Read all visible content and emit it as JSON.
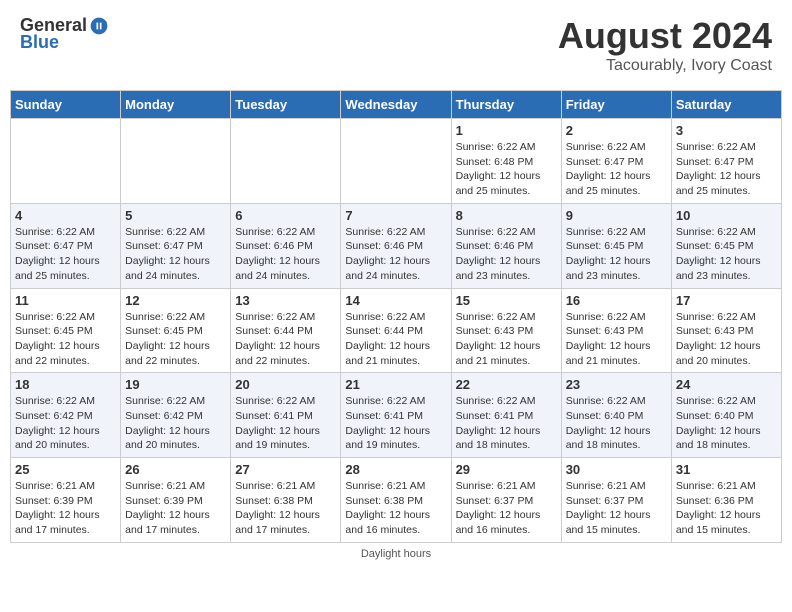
{
  "header": {
    "logo_general": "General",
    "logo_blue": "Blue",
    "main_title": "August 2024",
    "subtitle": "Tacourably, Ivory Coast"
  },
  "days_of_week": [
    "Sunday",
    "Monday",
    "Tuesday",
    "Wednesday",
    "Thursday",
    "Friday",
    "Saturday"
  ],
  "footer": {
    "text": "Daylight hours"
  },
  "weeks": [
    {
      "days": [
        {
          "num": "",
          "info": "",
          "empty": true
        },
        {
          "num": "",
          "info": "",
          "empty": true
        },
        {
          "num": "",
          "info": "",
          "empty": true
        },
        {
          "num": "",
          "info": "",
          "empty": true
        },
        {
          "num": "1",
          "info": "Sunrise: 6:22 AM\nSunset: 6:48 PM\nDaylight: 12 hours\nand 25 minutes."
        },
        {
          "num": "2",
          "info": "Sunrise: 6:22 AM\nSunset: 6:47 PM\nDaylight: 12 hours\nand 25 minutes."
        },
        {
          "num": "3",
          "info": "Sunrise: 6:22 AM\nSunset: 6:47 PM\nDaylight: 12 hours\nand 25 minutes."
        }
      ]
    },
    {
      "days": [
        {
          "num": "4",
          "info": "Sunrise: 6:22 AM\nSunset: 6:47 PM\nDaylight: 12 hours\nand 25 minutes."
        },
        {
          "num": "5",
          "info": "Sunrise: 6:22 AM\nSunset: 6:47 PM\nDaylight: 12 hours\nand 24 minutes."
        },
        {
          "num": "6",
          "info": "Sunrise: 6:22 AM\nSunset: 6:46 PM\nDaylight: 12 hours\nand 24 minutes."
        },
        {
          "num": "7",
          "info": "Sunrise: 6:22 AM\nSunset: 6:46 PM\nDaylight: 12 hours\nand 24 minutes."
        },
        {
          "num": "8",
          "info": "Sunrise: 6:22 AM\nSunset: 6:46 PM\nDaylight: 12 hours\nand 23 minutes."
        },
        {
          "num": "9",
          "info": "Sunrise: 6:22 AM\nSunset: 6:45 PM\nDaylight: 12 hours\nand 23 minutes."
        },
        {
          "num": "10",
          "info": "Sunrise: 6:22 AM\nSunset: 6:45 PM\nDaylight: 12 hours\nand 23 minutes."
        }
      ]
    },
    {
      "days": [
        {
          "num": "11",
          "info": "Sunrise: 6:22 AM\nSunset: 6:45 PM\nDaylight: 12 hours\nand 22 minutes."
        },
        {
          "num": "12",
          "info": "Sunrise: 6:22 AM\nSunset: 6:45 PM\nDaylight: 12 hours\nand 22 minutes."
        },
        {
          "num": "13",
          "info": "Sunrise: 6:22 AM\nSunset: 6:44 PM\nDaylight: 12 hours\nand 22 minutes."
        },
        {
          "num": "14",
          "info": "Sunrise: 6:22 AM\nSunset: 6:44 PM\nDaylight: 12 hours\nand 21 minutes."
        },
        {
          "num": "15",
          "info": "Sunrise: 6:22 AM\nSunset: 6:43 PM\nDaylight: 12 hours\nand 21 minutes."
        },
        {
          "num": "16",
          "info": "Sunrise: 6:22 AM\nSunset: 6:43 PM\nDaylight: 12 hours\nand 21 minutes."
        },
        {
          "num": "17",
          "info": "Sunrise: 6:22 AM\nSunset: 6:43 PM\nDaylight: 12 hours\nand 20 minutes."
        }
      ]
    },
    {
      "days": [
        {
          "num": "18",
          "info": "Sunrise: 6:22 AM\nSunset: 6:42 PM\nDaylight: 12 hours\nand 20 minutes."
        },
        {
          "num": "19",
          "info": "Sunrise: 6:22 AM\nSunset: 6:42 PM\nDaylight: 12 hours\nand 20 minutes."
        },
        {
          "num": "20",
          "info": "Sunrise: 6:22 AM\nSunset: 6:41 PM\nDaylight: 12 hours\nand 19 minutes."
        },
        {
          "num": "21",
          "info": "Sunrise: 6:22 AM\nSunset: 6:41 PM\nDaylight: 12 hours\nand 19 minutes."
        },
        {
          "num": "22",
          "info": "Sunrise: 6:22 AM\nSunset: 6:41 PM\nDaylight: 12 hours\nand 18 minutes."
        },
        {
          "num": "23",
          "info": "Sunrise: 6:22 AM\nSunset: 6:40 PM\nDaylight: 12 hours\nand 18 minutes."
        },
        {
          "num": "24",
          "info": "Sunrise: 6:22 AM\nSunset: 6:40 PM\nDaylight: 12 hours\nand 18 minutes."
        }
      ]
    },
    {
      "days": [
        {
          "num": "25",
          "info": "Sunrise: 6:21 AM\nSunset: 6:39 PM\nDaylight: 12 hours\nand 17 minutes."
        },
        {
          "num": "26",
          "info": "Sunrise: 6:21 AM\nSunset: 6:39 PM\nDaylight: 12 hours\nand 17 minutes."
        },
        {
          "num": "27",
          "info": "Sunrise: 6:21 AM\nSunset: 6:38 PM\nDaylight: 12 hours\nand 17 minutes."
        },
        {
          "num": "28",
          "info": "Sunrise: 6:21 AM\nSunset: 6:38 PM\nDaylight: 12 hours\nand 16 minutes."
        },
        {
          "num": "29",
          "info": "Sunrise: 6:21 AM\nSunset: 6:37 PM\nDaylight: 12 hours\nand 16 minutes."
        },
        {
          "num": "30",
          "info": "Sunrise: 6:21 AM\nSunset: 6:37 PM\nDaylight: 12 hours\nand 15 minutes."
        },
        {
          "num": "31",
          "info": "Sunrise: 6:21 AM\nSunset: 6:36 PM\nDaylight: 12 hours\nand 15 minutes."
        }
      ]
    }
  ]
}
